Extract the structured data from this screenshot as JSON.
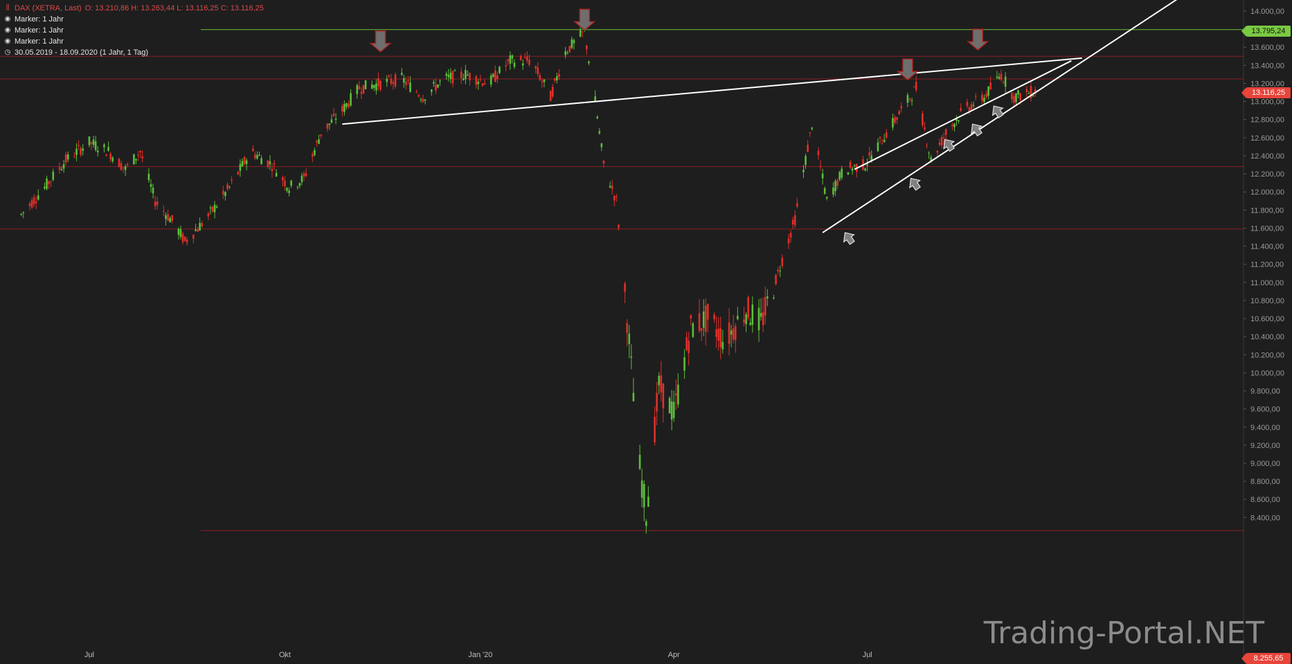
{
  "legend": {
    "title": "DAX (XETRA, Last)",
    "ohlc": "O: 13.210,86  H: 13.263,44  L: 13.116,25  C: 13.116,25",
    "markers": [
      "Marker: 1 Jahr",
      "Marker: 1 Jahr",
      "Marker: 1 Jahr"
    ],
    "range": "30.05.2019 - 18.09.2020   (1 Jahr, 1 Tag)"
  },
  "watermark": "Trading-Portal.NET",
  "badges": {
    "resistance": "13.795,24",
    "last": "13.116,25",
    "bottom": "8.255,65"
  },
  "colors": {
    "background": "#1e1e1e",
    "up": "#5cbf3a",
    "down": "#e0302a",
    "hline_red": "#8b1e24",
    "hline_green": "#6bbf3a"
  },
  "chart_data": {
    "type": "candlestick",
    "title": "DAX (XETRA, Last)",
    "xlabel": "",
    "ylabel": "",
    "x_ticks": [
      "Jul",
      "Okt",
      "Jan '20",
      "Apr",
      "Jul"
    ],
    "x_tick_dates": [
      "2019-07-01",
      "2019-10-01",
      "2020-01-01",
      "2020-04-01",
      "2020-07-01"
    ],
    "x_range": [
      "2019-05-20",
      "2020-12-25"
    ],
    "y_ticks": [
      "14.000,00",
      "13.800,00",
      "13.600,00",
      "13.400,00",
      "13.200,00",
      "13.000,00",
      "12.800,00",
      "12.600,00",
      "12.400,00",
      "12.200,00",
      "12.000,00",
      "11.800,00",
      "11.600,00",
      "11.400,00",
      "11.200,00",
      "11.000,00",
      "10.800,00",
      "10.600,00",
      "10.400,00",
      "10.200,00",
      "10.000,00",
      "9.800,00",
      "9.600,00",
      "9.400,00",
      "9.200,00",
      "9.000,00",
      "8.800,00",
      "8.600,00",
      "8.400,00"
    ],
    "ylim": [
      8255,
      14100
    ],
    "axis_position": "right",
    "grid": false,
    "series_path": [
      [
        "2019-05-30",
        11750
      ],
      [
        "2019-06-10",
        12050
      ],
      [
        "2019-06-20",
        12350
      ],
      [
        "2019-07-01",
        12550
      ],
      [
        "2019-07-10",
        12450
      ],
      [
        "2019-07-18",
        12250
      ],
      [
        "2019-07-25",
        12450
      ],
      [
        "2019-08-01",
        11900
      ],
      [
        "2019-08-10",
        11650
      ],
      [
        "2019-08-15",
        11450
      ],
      [
        "2019-08-25",
        11700
      ],
      [
        "2019-09-05",
        12050
      ],
      [
        "2019-09-15",
        12450
      ],
      [
        "2019-09-25",
        12300
      ],
      [
        "2019-10-03",
        12050
      ],
      [
        "2019-10-10",
        12150
      ],
      [
        "2019-10-18",
        12650
      ],
      [
        "2019-10-28",
        12900
      ],
      [
        "2019-11-05",
        13150
      ],
      [
        "2019-11-15",
        13200
      ],
      [
        "2019-11-25",
        13250
      ],
      [
        "2019-12-05",
        13050
      ],
      [
        "2019-12-15",
        13250
      ],
      [
        "2019-12-25",
        13300
      ],
      [
        "2020-01-05",
        13200
      ],
      [
        "2020-01-15",
        13450
      ],
      [
        "2020-01-25",
        13450
      ],
      [
        "2020-02-03",
        13050
      ],
      [
        "2020-02-10",
        13550
      ],
      [
        "2020-02-19",
        13770
      ],
      [
        "2020-02-24",
        13000
      ],
      [
        "2020-02-28",
        12300
      ],
      [
        "2020-03-05",
        11900
      ],
      [
        "2020-03-10",
        10600
      ],
      [
        "2020-03-16",
        8950
      ],
      [
        "2020-03-19",
        8450
      ],
      [
        "2020-03-25",
        9850
      ],
      [
        "2020-04-01",
        9550
      ],
      [
        "2020-04-09",
        10500
      ],
      [
        "2020-04-17",
        10600
      ],
      [
        "2020-04-25",
        10350
      ],
      [
        "2020-05-05",
        10700
      ],
      [
        "2020-05-12",
        10550
      ],
      [
        "2020-05-20",
        11100
      ],
      [
        "2020-05-28",
        11700
      ],
      [
        "2020-06-05",
        12750
      ],
      [
        "2020-06-12",
        11900
      ],
      [
        "2020-06-20",
        12250
      ],
      [
        "2020-06-30",
        12300
      ],
      [
        "2020-07-10",
        12650
      ],
      [
        "2020-07-17",
        12900
      ],
      [
        "2020-07-24",
        13150
      ],
      [
        "2020-07-31",
        12350
      ],
      [
        "2020-08-07",
        12650
      ],
      [
        "2020-08-15",
        12900
      ],
      [
        "2020-08-25",
        13050
      ],
      [
        "2020-09-02",
        13300
      ],
      [
        "2020-09-08",
        13050
      ],
      [
        "2020-09-18",
        13116
      ]
    ],
    "horizontal_lines": [
      {
        "y": 13795.24,
        "color": "green"
      },
      {
        "y": 13500,
        "color": "red"
      },
      {
        "y": 13250,
        "color": "red"
      },
      {
        "y": 12280,
        "color": "red"
      },
      {
        "y": 11590,
        "color": "red"
      },
      {
        "y": 8255.65,
        "color": "red"
      }
    ],
    "trendlines": [
      {
        "from": [
          "2019-10-28",
          12750
        ],
        "to": [
          "2020-10-10",
          13480
        ]
      },
      {
        "from": [
          "2020-06-10",
          11550
        ],
        "to": [
          "2020-11-25",
          14150
        ]
      },
      {
        "from": [
          "2020-06-25",
          12250
        ],
        "to": [
          "2020-10-05",
          13450
        ]
      }
    ],
    "down_arrows": [
      [
        "2019-11-15",
        13780
      ],
      [
        "2020-02-19",
        14020
      ],
      [
        "2020-07-20",
        13470
      ],
      [
        "2020-08-22",
        13800
      ]
    ],
    "up_arrows": [
      [
        "2020-06-22",
        11500
      ],
      [
        "2020-07-23",
        12100
      ],
      [
        "2020-08-08",
        12530
      ],
      [
        "2020-08-21",
        12700
      ],
      [
        "2020-08-31",
        12900
      ]
    ]
  }
}
